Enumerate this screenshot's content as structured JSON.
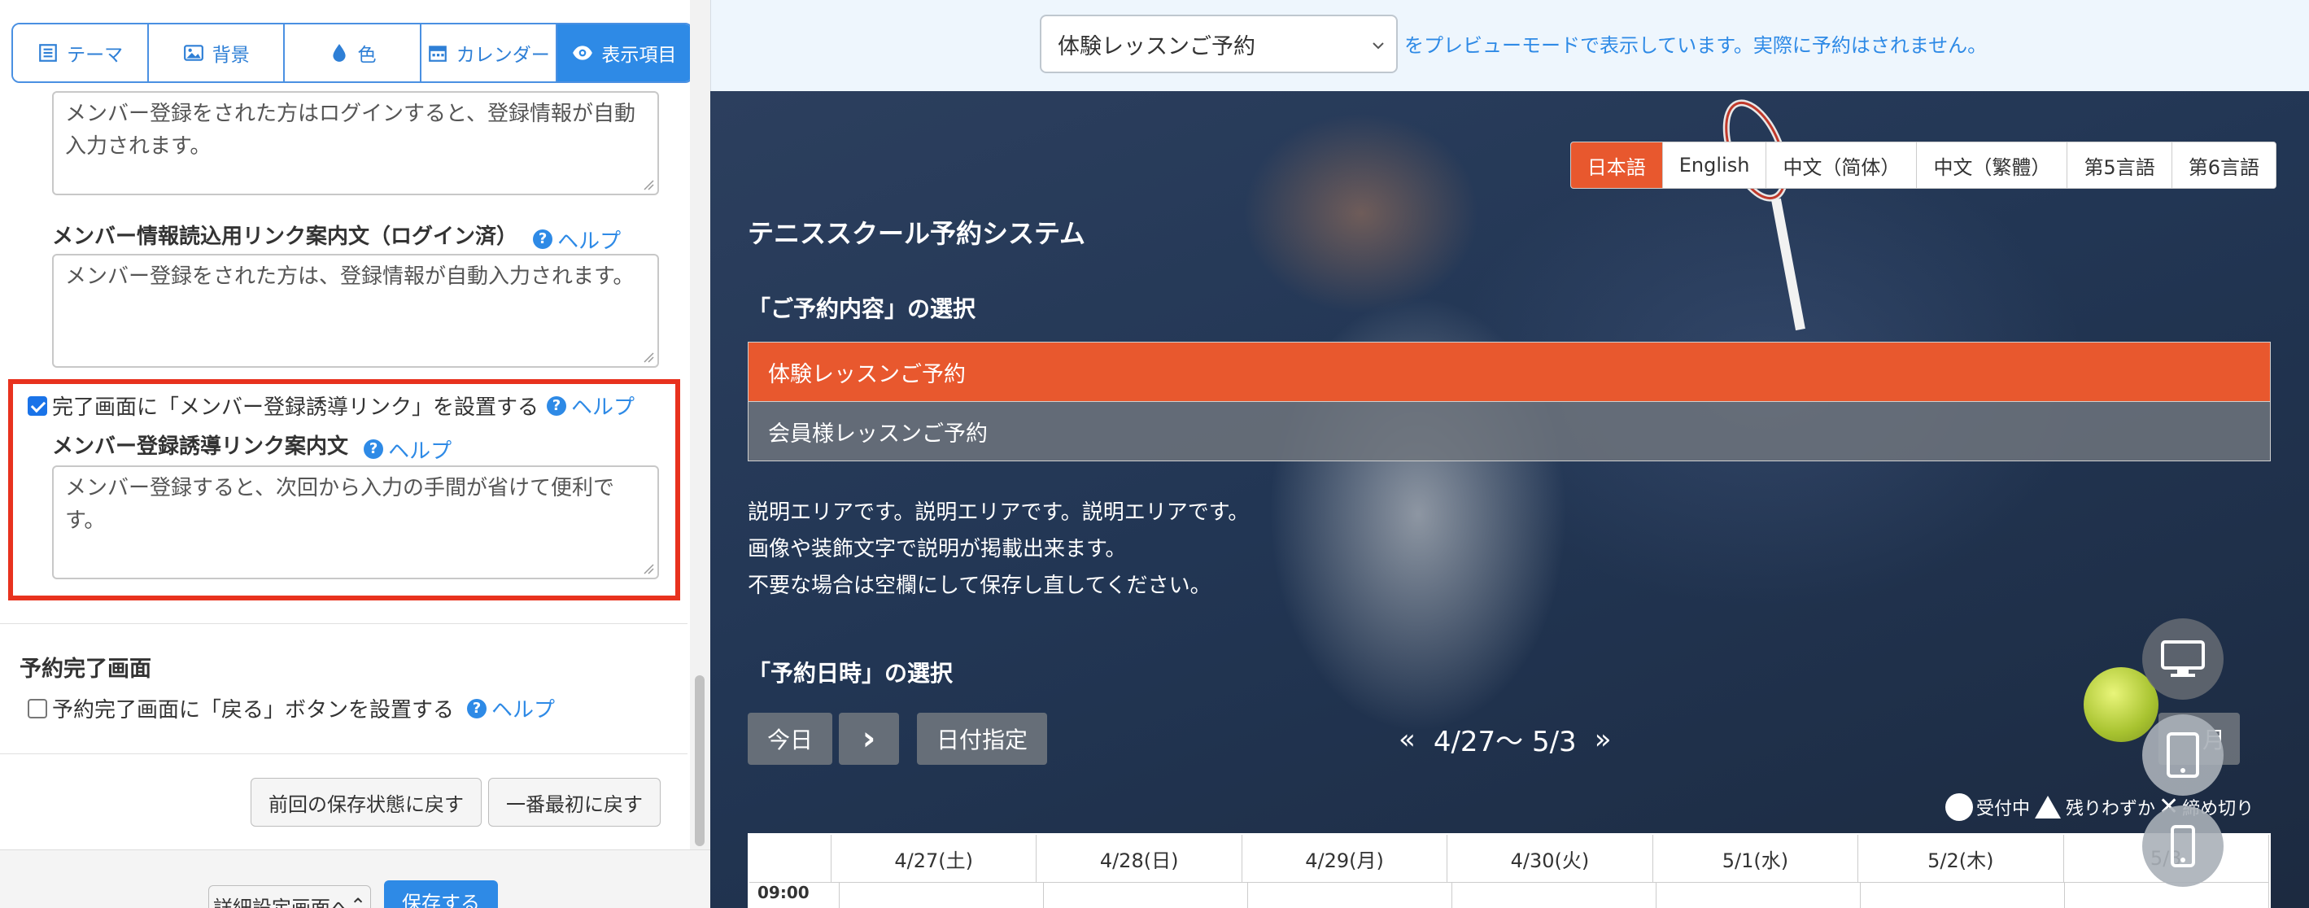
{
  "tabs": [
    {
      "label": "テーマ",
      "icon": "list-icon",
      "active": false
    },
    {
      "label": "背景",
      "icon": "image-icon",
      "active": false
    },
    {
      "label": "色",
      "icon": "droplet-icon",
      "active": false
    },
    {
      "label": "カレンダー",
      "icon": "calendar-icon",
      "active": false
    },
    {
      "label": "表示項目",
      "icon": "eye-icon",
      "active": true
    }
  ],
  "settings": {
    "login_textarea_value": "メンバー登録をされた方はログインすると、登録情報が自動入力されます。",
    "member_info_label": "メンバー情報読込用リンク案内文（ログイン済）",
    "member_info_value": "メンバー登録をされた方は、登録情報が自動入力されます。",
    "member_link_checkbox_label": "完了画面に「メンバー登録誘導リンク」を設置する",
    "member_link_checked": true,
    "member_link_text_label": "メンバー登録誘導リンク案内文",
    "member_link_text_value": "メンバー登録すると、次回から入力の手間が省けて便利です。",
    "help_label": "ヘルプ",
    "completion_section_title": "予約完了画面",
    "back_button_checkbox_label": "予約完了画面に「戻る」ボタンを設置する",
    "back_button_checked": false,
    "revert_button": "前回の保存状態に戻す",
    "reset_button": "一番最初に戻す",
    "detail_settings_button": "詳細設定画面へ",
    "save_button": "保存する"
  },
  "preview": {
    "selected_menu": "体験レッスンご予約",
    "note": "をプレビューモードで表示しています。実際に予約はされません。",
    "languages": [
      {
        "label": "日本語",
        "active": true
      },
      {
        "label": "English",
        "active": false
      },
      {
        "label": "中文（简体）",
        "active": false
      },
      {
        "label": "中文（繁體）",
        "active": false
      },
      {
        "label": "第5言語",
        "active": false
      },
      {
        "label": "第6言語",
        "active": false
      }
    ],
    "site_title": "テニススクール予約システム",
    "menu_section_title": "「ご予約内容」の選択",
    "menu_items": [
      {
        "label": "体験レッスンご予約",
        "active": true
      },
      {
        "label": "会員様レッスンご予約",
        "active": false
      }
    ],
    "description_lines": [
      "説明エリアです。説明エリアです。説明エリアです。",
      "画像や装飾文字で説明が掲載出来ます。",
      "不要な場合は空欄にして保存し直してください。"
    ],
    "date_section_title": "「予約日時」の選択",
    "today_button": "今日",
    "next_arrow": "›",
    "date_pick_button": "日付指定",
    "range_prev": "«",
    "range_label": "4/27〜 5/3",
    "range_next": "»",
    "month_button": "月",
    "legend": {
      "available": "受付中",
      "few": "残りわずか",
      "closed": "締め切り"
    },
    "days": [
      "4/27(土)",
      "4/28(日)",
      "4/29(月)",
      "4/30(火)",
      "5/1(水)",
      "5/2(木)",
      "5/3"
    ],
    "first_time": "09:00"
  },
  "colors": {
    "accent": "#2e8ae6",
    "highlight_red": "#e8321e",
    "menu_active": "#e8582e"
  }
}
